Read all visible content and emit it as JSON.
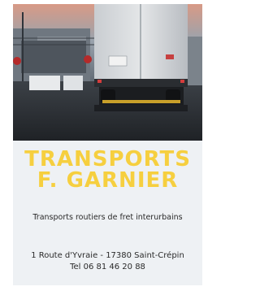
{
  "card": {
    "company_line1": "TRANSPORTS",
    "company_line2": "F. GARNIER",
    "tagline": "Transports routiers de fret interurbains",
    "address": "1 Route d'Yvraie - 17380 Saint-Crépin",
    "phone": "Tel 06 81 46 20 88"
  },
  "colors": {
    "accent": "#f6cf3f",
    "card_background": "#eef1f4",
    "text": "#2a2a2a"
  }
}
